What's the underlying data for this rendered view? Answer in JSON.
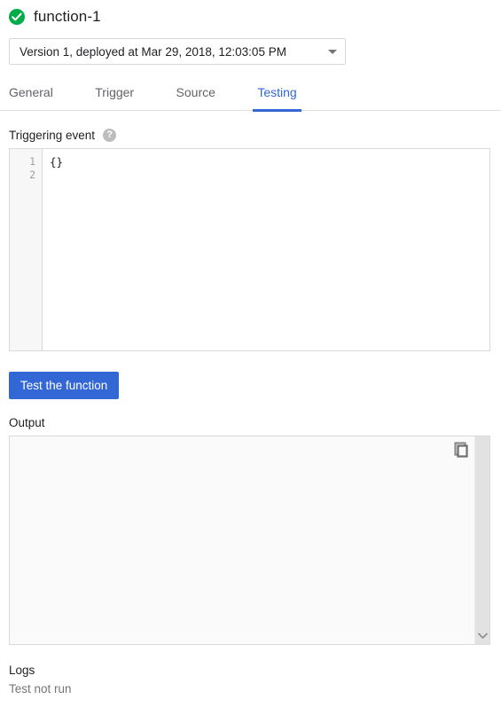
{
  "header": {
    "status_icon": "check-circle-icon",
    "status_color": "#00ac47",
    "title": "function-1"
  },
  "version_select": {
    "icon": "chevron-down-icon",
    "value": "Version 1, deployed at Mar 29, 2018, 12:03:05 PM"
  },
  "tabs": [
    {
      "label": "General",
      "active": false
    },
    {
      "label": "Trigger",
      "active": false
    },
    {
      "label": "Source",
      "active": false
    },
    {
      "label": "Testing",
      "active": true
    }
  ],
  "accent_color": "#3367d6",
  "triggering_event": {
    "label": "Triggering event",
    "help_icon": "help-circle-icon",
    "help_glyph": "?",
    "line_numbers": [
      "1",
      "2"
    ],
    "lines": [
      "{}",
      ""
    ]
  },
  "test_button": {
    "label": "Test the function"
  },
  "output": {
    "label": "Output",
    "value": "",
    "copy_icon": "copy-icon",
    "scroll_down_icon": "chevron-down-icon"
  },
  "logs": {
    "label": "Logs",
    "status": "Test not run"
  }
}
